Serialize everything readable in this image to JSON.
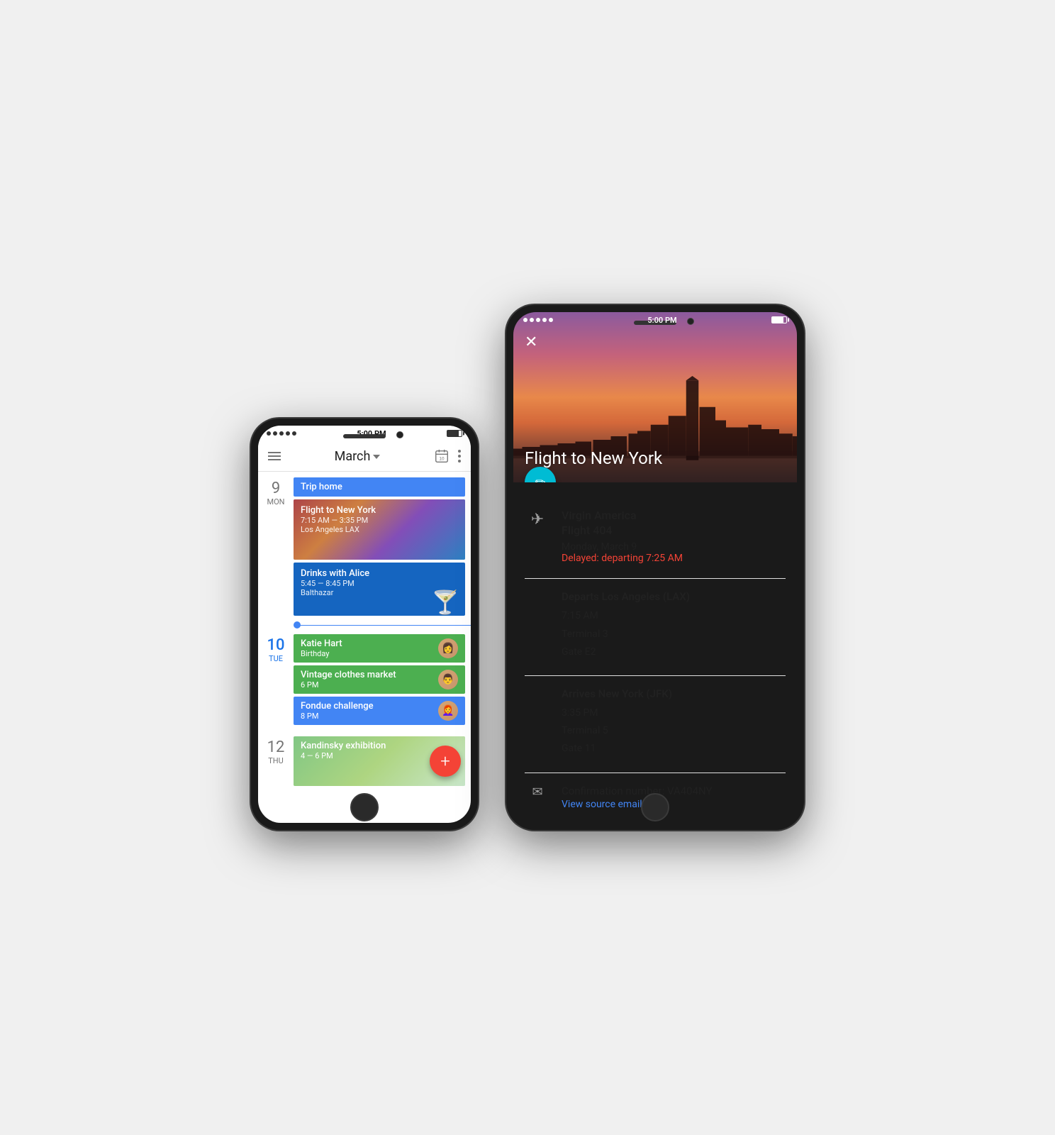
{
  "phone1": {
    "status": {
      "time": "5:00 PM"
    },
    "toolbar": {
      "title": "March",
      "menu_label": "Menu"
    },
    "days": [
      {
        "number": "9",
        "name": "Mon",
        "events": [
          {
            "type": "trip",
            "title": "Trip home"
          },
          {
            "type": "flight",
            "title": "Flight to New York",
            "time": "7:15 AM — 3:35 PM",
            "location": "Los Angeles LAX"
          },
          {
            "type": "drinks",
            "title": "Drinks with Alice",
            "time": "5:45 — 8:45 PM",
            "location": "Balthazar"
          }
        ]
      },
      {
        "number": "10",
        "name": "Tue",
        "today": true,
        "events": [
          {
            "type": "birthday",
            "title": "Katie Hart",
            "subtitle": "Birthday"
          },
          {
            "type": "vintage",
            "title": "Vintage clothes market",
            "time": "6 PM"
          },
          {
            "type": "fondue",
            "title": "Fondue challenge",
            "time": "8 PM"
          }
        ]
      },
      {
        "number": "12",
        "name": "Thu",
        "events": [
          {
            "type": "kandinsky",
            "title": "Kandinsky exhibition",
            "time": "4 — 6 PM"
          }
        ]
      }
    ]
  },
  "phone2": {
    "status": {
      "time": "5:00 PM"
    },
    "hero": {
      "title": "Flight to New York",
      "close_label": "×"
    },
    "detail": {
      "airline": "Virgin America",
      "flight_number": "Flight 404",
      "date": "Monday, March 9",
      "delayed": "Delayed: departing 7:25 AM",
      "departs_title": "Departs Los Angeles (LAX)",
      "departs_time": "7:15 AM",
      "departs_terminal": "Terminal 3",
      "departs_gate": "Gate E2",
      "arrives_title": "Arrives New York (JFK)",
      "arrives_time": "3:35 PM",
      "arrives_terminal": "Terminal 5",
      "arrives_gate": "Gate 11",
      "confirmation": "Confirmation number: VA404NY",
      "view_email": "View source email"
    }
  }
}
